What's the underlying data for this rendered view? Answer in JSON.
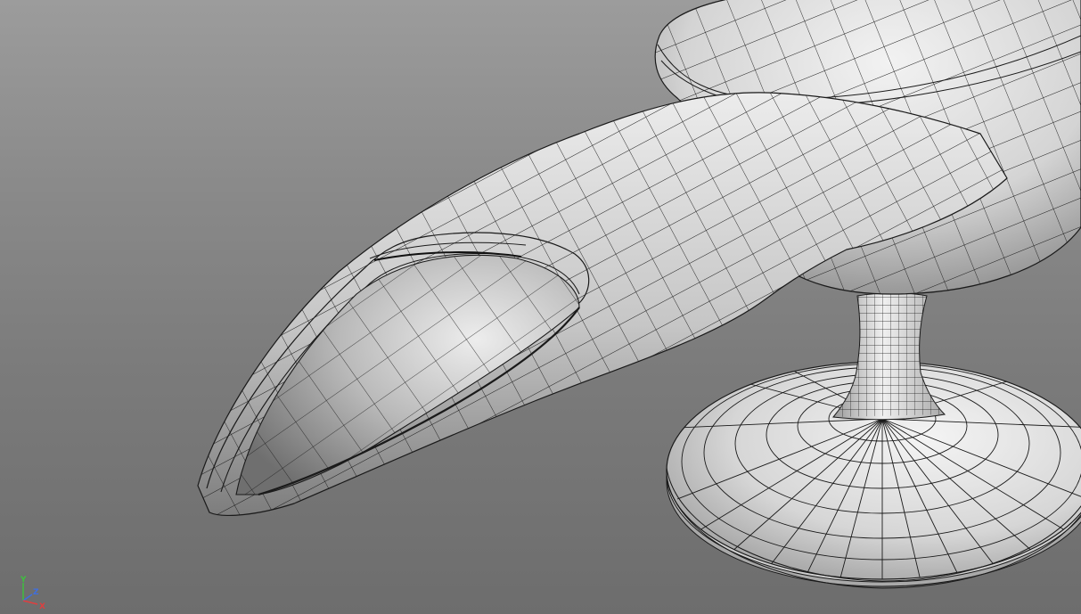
{
  "viewport": {
    "background_top": "#9c9c9c",
    "background_bottom": "#6d6d6d",
    "wire_color": "#1a1a1a"
  },
  "axis_gizmo": {
    "y_label": "Y",
    "z_label": "Z",
    "x_label": "X",
    "y_color": "#3fbf3f",
    "z_color": "#3f6fdf",
    "x_color": "#df3f3f"
  }
}
